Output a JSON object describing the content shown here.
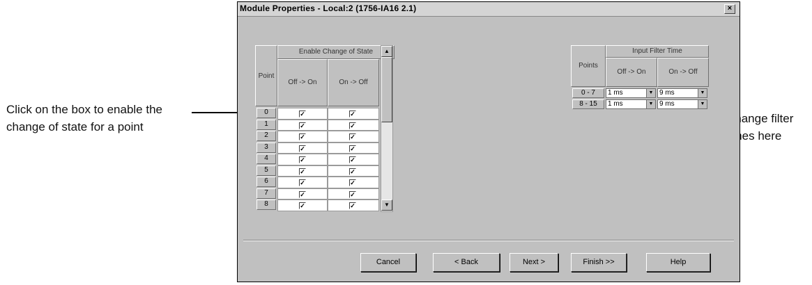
{
  "window": {
    "title": "Module Properties - Local:2 (1756-IA16 2.1)",
    "close_glyph": "×"
  },
  "annotations": {
    "left": "Click on the box to enable the change of state for a point",
    "right": "Change filter times here"
  },
  "cos_table": {
    "point_header": "Point",
    "group_header": "Enable Change of State",
    "col_off_on": "Off -> On",
    "col_on_off": "On -> Off",
    "rows": [
      {
        "point": "0",
        "off_on": true,
        "on_off": true
      },
      {
        "point": "1",
        "off_on": true,
        "on_off": true
      },
      {
        "point": "2",
        "off_on": true,
        "on_off": true
      },
      {
        "point": "3",
        "off_on": true,
        "on_off": true
      },
      {
        "point": "4",
        "off_on": true,
        "on_off": true
      },
      {
        "point": "5",
        "off_on": true,
        "on_off": true
      },
      {
        "point": "6",
        "off_on": true,
        "on_off": true
      },
      {
        "point": "7",
        "off_on": true,
        "on_off": true
      },
      {
        "point": "8",
        "off_on": true,
        "on_off": true
      }
    ],
    "check_glyph": "✓"
  },
  "filter_table": {
    "points_header": "Points",
    "group_header": "Input Filter Time",
    "col_off_on": "Off -> On",
    "col_on_off": "On -> Off",
    "rows": [
      {
        "points": "0 - 7",
        "off_on": "1 ms",
        "on_off": "9 ms"
      },
      {
        "points": "8 - 15",
        "off_on": "1 ms",
        "on_off": "9 ms"
      }
    ]
  },
  "buttons": {
    "cancel": "Cancel",
    "back": "< Back",
    "next": "Next >",
    "finish": "Finish >>",
    "help": "Help"
  },
  "icons": {
    "scroll_up": "up-arrow-icon",
    "scroll_down": "down-arrow-icon",
    "dropdown": "chevron-down-icon"
  }
}
